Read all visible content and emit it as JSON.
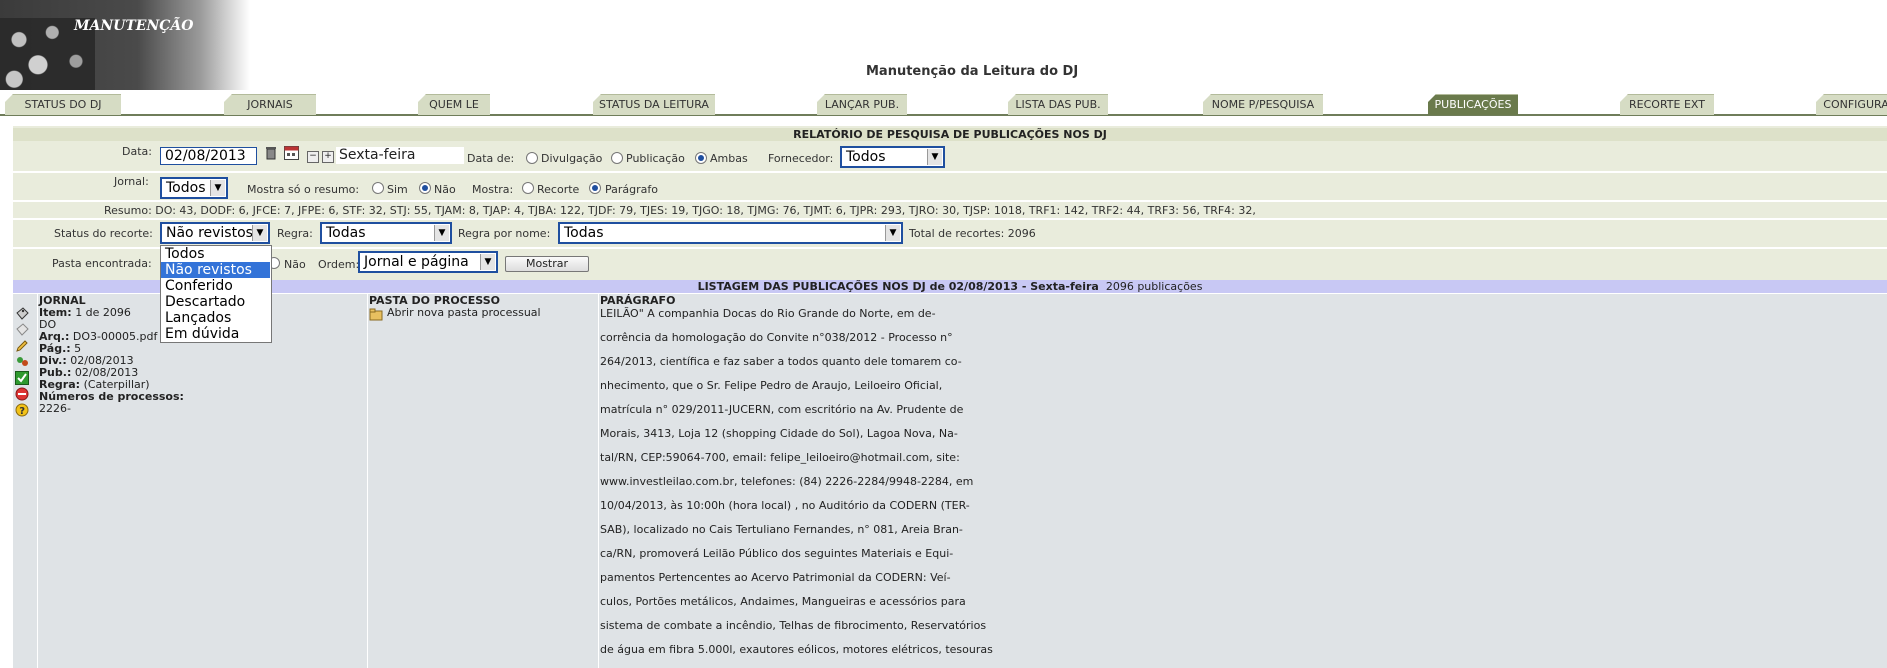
{
  "header": {
    "logo_text": "MANUTENÇÃO",
    "page_title": "Manutenção da Leitura do DJ"
  },
  "tabs": [
    {
      "label": "STATUS DO DJ"
    },
    {
      "label": "JORNAIS"
    },
    {
      "label": "QUEM LE"
    },
    {
      "label": "STATUS DA LEITURA"
    },
    {
      "label": "LANÇAR PUB."
    },
    {
      "label": "LISTA DAS PUB."
    },
    {
      "label": "NOME P/PESQUISA"
    },
    {
      "label": "PUBLICAÇÕES"
    },
    {
      "label": "RECORTE EXT"
    },
    {
      "label": "CONFIGURA"
    }
  ],
  "report": {
    "title": "RELATÓRIO DE PESQUISA DE PUBLICAÇÕES NOS DJ",
    "data_label": "Data:",
    "data_value": "02/08/2013",
    "weekday": "Sexta-feira",
    "data_de_label": "Data de:",
    "data_de_options": [
      "Divulgação",
      "Publicação",
      "Ambas"
    ],
    "fornecedor_label": "Fornecedor:",
    "fornecedor_value": "Todos",
    "jornal_label": "Jornal:",
    "jornal_value": "Todos",
    "mostra_resumo_label": "Mostra só o resumo:",
    "resumo_options": [
      "Sim",
      "Não"
    ],
    "mostra_label": "Mostra:",
    "mostra_options": [
      "Recorte",
      "Parágrafo"
    ],
    "resumo_text": "Resumo: DO: 43,  DODF: 6,  JFCE: 7,  JFPE: 6,  STF: 32,  STJ: 55,  TJAM: 8,  TJAP: 4,  TJBA: 122,  TJDF: 79,  TJES: 19,  TJGO: 18,  TJMG: 76,  TJMT: 6,  TJPR: 293,  TJRO: 30,  TJSP: 1018,  TRF1: 142,  TRF2: 44,  TRF3: 56,  TRF4: 32,",
    "status_label": "Status do recorte:",
    "status_value": "Não revistos",
    "regra_label": "Regra:",
    "regra_value": "Todas",
    "regra_nome_label": "Regra por nome:",
    "regra_nome_value": "Todas",
    "total_recortes": "Total de recortes: 2096",
    "pasta_label": "Pasta encontrada:",
    "nao_label": "Não",
    "ordem_label": "Ordem:",
    "ordem_value": "Jornal e página",
    "mostrar_button": "Mostrar",
    "status_options": [
      "Todos",
      "Não revistos",
      "Conferido",
      "Descartado",
      "Lançados",
      "Em dúvida"
    ]
  },
  "listing": {
    "title": "LISTAGEM DAS PUBLICAÇÕES NOS DJ de 02/08/2013 - Sexta-feira",
    "count": "2096 publicações",
    "col_jornal": "JORNAL",
    "col_pasta": "PASTA DO PROCESSO",
    "col_paragrafo": "PARÁGRAFO",
    "item": {
      "item_label": "Item:",
      "item_value": "1 de 2096",
      "jornal": "DO",
      "arq_label": "Arq.:",
      "arq_value": "DO3-00005.pdf",
      "pag_label": "Pág.:",
      "pag_value": "5",
      "div_label": "Div.:",
      "div_value": "02/08/2013",
      "pub_label": "Pub.:",
      "pub_value": "02/08/2013",
      "regra_label": "Regra:",
      "regra_value": "(Caterpillar)",
      "numeros_label": "Números de processos:",
      "numeros_value": "2226-"
    },
    "pasta_link": "Abrir nova pasta processual",
    "paragraph_lines": [
      "LEILÃO\" A companhia Docas do Rio Grande do Norte, em de-",
      "corrência da homologação do Convite n°038/2012 - Processo n°",
      "264/2013, científica e faz saber a todos quanto dele tomarem co-",
      "nhecimento, que o Sr. Felipe Pedro de Araujo, Leiloeiro Oficial,",
      "matrícula n° 029/2011-JUCERN, com escritório na Av. Prudente de",
      "Morais, 3413, Loja 12 (shopping Cidade do Sol), Lagoa Nova, Na-",
      "tal/RN, CEP:59064-700, email: felipe_leiloeiro@hotmail.com, site:",
      "www.investleilao.com.br, telefones: (84) 2226-2284/9948-2284, em",
      "10/04/2013, às 10:00h (hora local) , no Auditório da CODERN (TER-",
      "SAB), localizado no Cais Tertuliano Fernandes, n° 081, Areia Bran-",
      "ca/RN, promoverá Leilão Público dos seguintes Materiais e Equi-",
      "pamentos Pertencentes ao Acervo Patrimonial da CODERN: Veí-",
      "culos, Portões metálicos, Andaimes, Mangueiras e acessórios para",
      "sistema de combate a incêndio, Telhas de fibrocimento, Reservatórios",
      "de água em fibra 5.000l, exautores eólicos, motores elétricos, tesouras"
    ]
  }
}
